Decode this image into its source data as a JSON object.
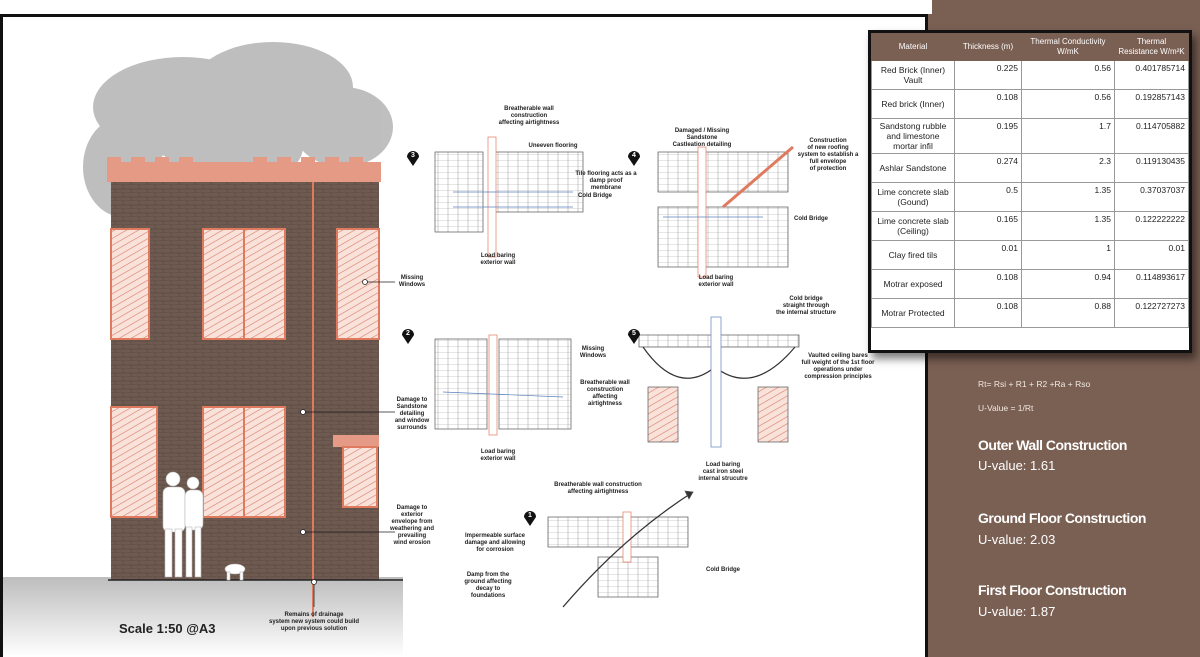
{
  "callouts": {
    "missing_windows": "Missing\nWindows",
    "damage_sandstone": "Damage to\nSandstone\ndetailing\nand window\nsurrounds",
    "damage_envelope": "Damage to\nexterior\nenvelope from\nweathering and\nprevailing\nwind erosion",
    "drainage": "Remains of drainage\nsystem new system could build\nupon previous solution",
    "d3_breathable": "Breatherable wall\nconstruction\naffecting airtightness",
    "d3_uneven": "Uneeven flooring",
    "d3_tile": "Tile flooring acts as a\ndamp proof membrane",
    "d3_cold": "Cold Bridge",
    "d3_load": "Load baring\nexterior wall",
    "d4_damaged": "Damaged / Missing\nSandstone\nCastleation detailing",
    "d4_construction": "Construction\nof new roofing\nsystem to establish a\nfull envelope\nof protection",
    "d4_cold": "Cold Bridge",
    "d4_load": "Load baring\nexterior wall",
    "d2_missing": "Missing\nWindows",
    "d2_breathable": "Breatherable wall\nconstruction\naffecting airtightness",
    "d2_load": "Load baring\nexterior wall",
    "d5_cold": "Cold bridge\nstraight through\nthe internal structure",
    "d5_vaulted": "Vaulted ceiling bares\nfull weight of the 1st floor\noperations under\ncompression principles",
    "d5_load": "Load baring\ncast iron steel\ninternal strucutre",
    "d1_breathable": "Breatherable wall construction\naffecting airtightness",
    "d1_impermeable": "Impermeable surface\ndamage and allowing\nfor corrosion",
    "d1_damp": "Damp from the\nground affecting\ndecay to foundations",
    "d1_cold": "Cold Bridge"
  },
  "markers": [
    "3",
    "4",
    "2",
    "5",
    "1"
  ],
  "scale": "Scale 1:50 @A3",
  "table": {
    "headers": [
      "Material",
      "Thickness (m)",
      "Thermal Conductivity W/mK",
      "Thermal Resistance W/m²K"
    ],
    "rows": [
      {
        "material": "Red Brick (Inner) Vault",
        "thickness": "0.225",
        "conductivity": "0.56",
        "resistance": "0.401785714"
      },
      {
        "material": "Red brick (Inner)",
        "thickness": "0.108",
        "conductivity": "0.56",
        "resistance": "0.192857143"
      },
      {
        "material": "Sandstong rubble and limestone mortar infil",
        "thickness": "0.195",
        "conductivity": "1.7",
        "resistance": "0.114705882"
      },
      {
        "material": "Ashlar Sandstone",
        "thickness": "0.274",
        "conductivity": "2.3",
        "resistance": "0.119130435"
      },
      {
        "material": "Lime concrete slab (Gound)",
        "thickness": "0.5",
        "conductivity": "1.35",
        "resistance": "0.37037037"
      },
      {
        "material": "Lime concrete slab (Ceiling)",
        "thickness": "0.165",
        "conductivity": "1.35",
        "resistance": "0.122222222"
      },
      {
        "material": "Clay fired tils",
        "thickness": "0.01",
        "conductivity": "1",
        "resistance": "0.01"
      },
      {
        "material": "Motrar exposed",
        "thickness": "0.108",
        "conductivity": "0.94",
        "resistance": "0.114893617"
      },
      {
        "material": "Motrar Protected",
        "thickness": "0.108",
        "conductivity": "0.88",
        "resistance": "0.122727273"
      }
    ]
  },
  "formula": {
    "rt": "Rt= Rsi + R1 + R2 +Ra + Rso",
    "u": "U-Value = 1/Rt"
  },
  "sections": [
    {
      "title": "Outer Wall Construction",
      "value": "U-value: 1.61"
    },
    {
      "title": "Ground Floor Construction",
      "value": "U-value: 2.03"
    },
    {
      "title": "First Floor Construction",
      "value": "U-value: 1.87"
    }
  ],
  "colors": {
    "panel": "#7a5f53",
    "brick": "#6e5a50",
    "accent": "#e07a5f",
    "glass": "#f6d8cf"
  }
}
